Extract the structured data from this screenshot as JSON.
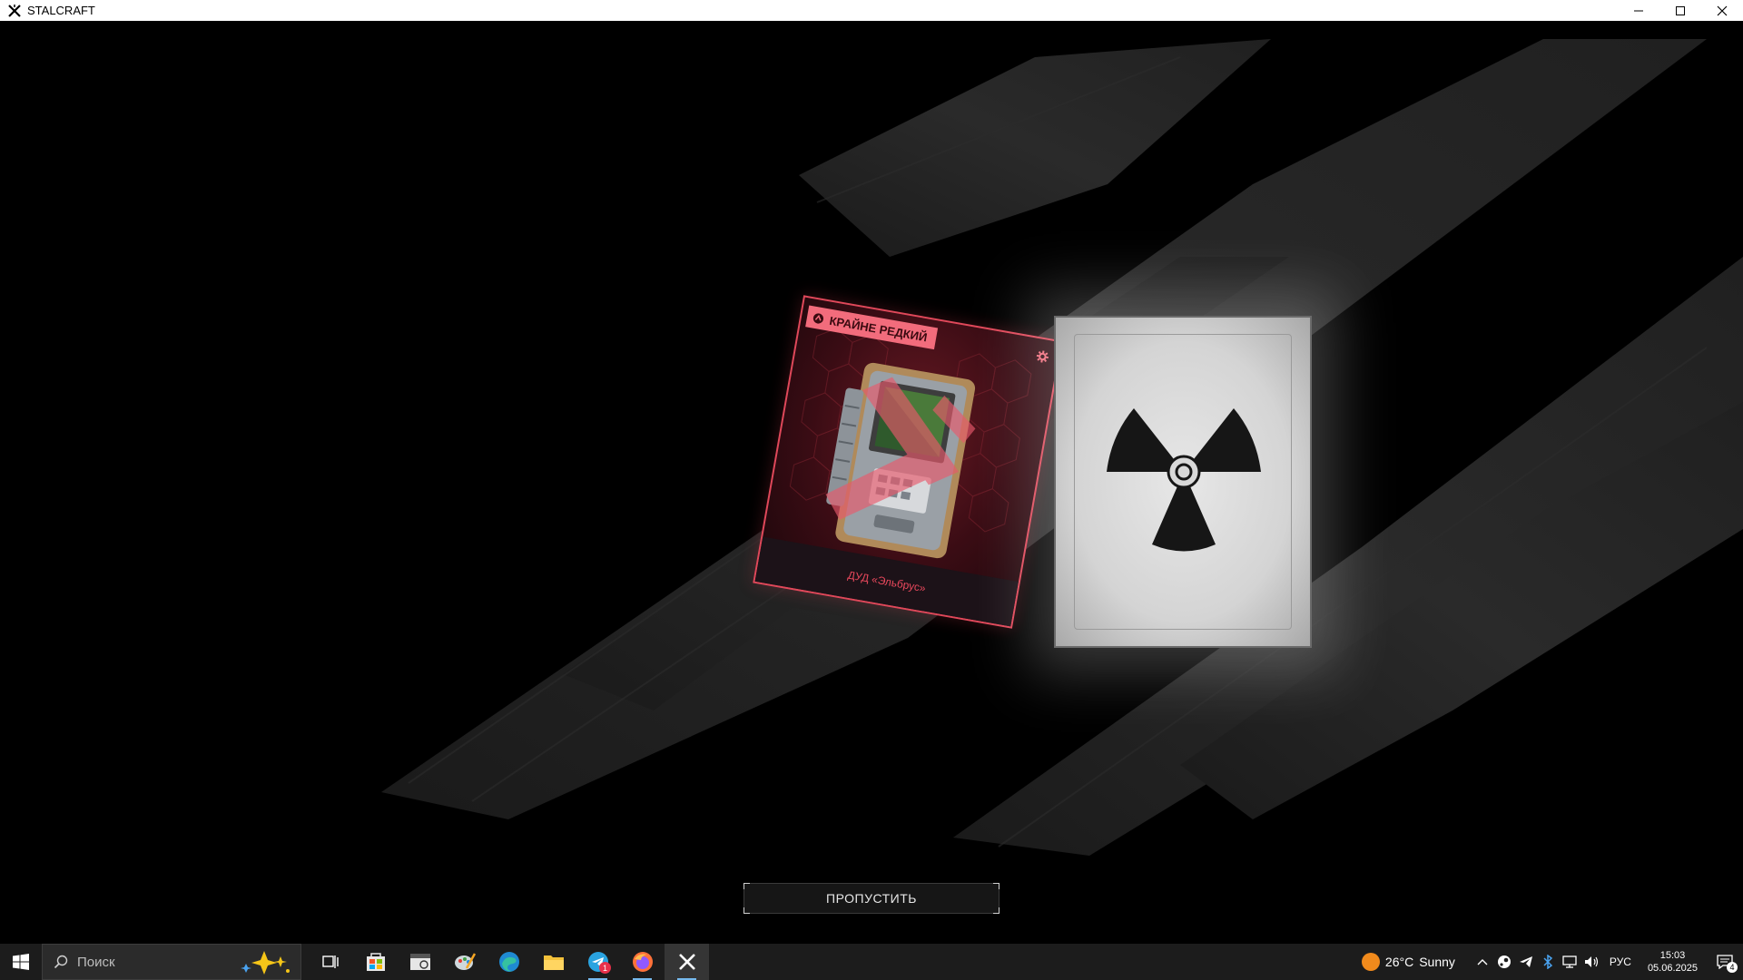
{
  "window": {
    "title": "STALCRAFT"
  },
  "reward_card": {
    "rarity": "КРАЙНЕ РЕДКИЙ",
    "item_name": "ДУД «Эльбрус»",
    "rarity_color": "#f26c7c",
    "border_color": "#e0485a"
  },
  "facedown_card": {
    "icon": "radiation-icon"
  },
  "skip_button": {
    "label": "ПРОПУСТИТЬ"
  },
  "taskbar": {
    "search_placeholder": "Поиск",
    "apps": [
      "task-view-icon",
      "store-icon",
      "calendar-app-icon",
      "paint-icon",
      "edge-icon",
      "file-explorer-icon",
      "telegram-icon",
      "firefox-icon",
      "stalcraft-icon"
    ],
    "telegram_badge": "1",
    "weather": {
      "temp": "26°C",
      "condition": "Sunny"
    },
    "language": "РУС",
    "time": "15:03",
    "date": "05.06.2025",
    "notifications": "4"
  }
}
